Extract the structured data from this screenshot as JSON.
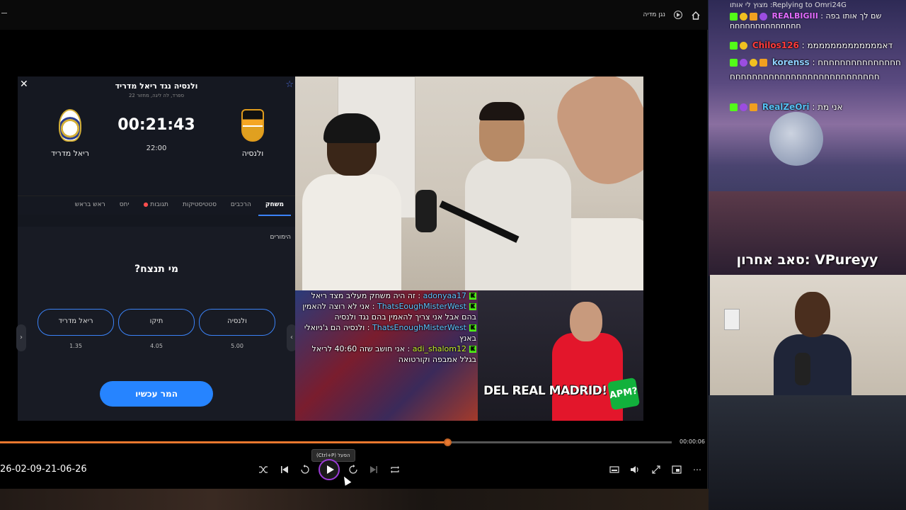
{
  "player": {
    "app_title": "נגן מדיה",
    "file_name": "26-02-09-21-06-26",
    "time_current": "00:00:06",
    "progress_fraction": 0.666,
    "tooltip": "הפעל (Ctrl+P)",
    "icons": [
      "home-icon",
      "media-player-icon",
      "shuffle-icon",
      "previous-icon",
      "rewind-10-icon",
      "play-icon",
      "forward-30-icon",
      "next-icon",
      "repeat-icon",
      "mini-player-icon",
      "volume-icon",
      "fullscreen-icon",
      "cast-icon",
      "more-icon"
    ]
  },
  "match_app": {
    "title": "ולנסיה נגד ריאל מדריד",
    "subtitle": "ספרד, לה ליגה, מחזור 22",
    "timer": "00:21:43",
    "kickoff": "22:00",
    "home_team": "ולנסיה",
    "away_team": "ריאל מדריד",
    "tabs": [
      "משחק",
      "הרכבים",
      "סטטיסטיקות",
      "תגובות",
      "יחס",
      "ראש בראש"
    ],
    "predict_label": "הימורים",
    "question": "מי תנצח?",
    "options": [
      {
        "label": "ולנסיה",
        "odd": "5.00"
      },
      {
        "label": "תיקו",
        "odd": "4.05"
      },
      {
        "label": "ריאל מדריד",
        "odd": "1.35"
      }
    ],
    "bet_button": "המר עכשיו"
  },
  "overlay_chat": [
    {
      "user": "adonyaa17",
      "text": "זה היה משחק מעליב מצד ריאל"
    },
    {
      "user": "ThatsEoughMisterWest",
      "text": "אני לא רוצה להאמין בהם אבל אני צריך להאמין בהם נגד ולנסיה"
    },
    {
      "user": "ThatsEnoughMisterWest",
      "text": "ולנסיה הם ג'ניואלי באנץ"
    },
    {
      "user": "adi_shalom12",
      "text": "אני חושב שזה 40:60 לריאל בגלל אמבפה וקורטואה"
    }
  ],
  "ref_caption": "DEL REAL MADRID!",
  "ref_badge": "APM?",
  "stream_chat": {
    "reply_header": "Replying to Omri24G: מצוץ לי אותו",
    "reply_user": "REALBIGIII",
    "reply_text": "שם לך אותו בפה חחחחחחחחחחחחחח",
    "messages": [
      {
        "user": "Chilos126",
        "text": "דאמממממממממממממ"
      },
      {
        "user": "korenss",
        "text": "חחחחחחחחחחחחחחחחחחחחחחחחחחחחחחחחחחחחחחחחחח"
      },
      {
        "user": "RealZeOri",
        "text": "אני מת"
      }
    ],
    "last_sub": "סאב אחרון: VPureyy"
  }
}
